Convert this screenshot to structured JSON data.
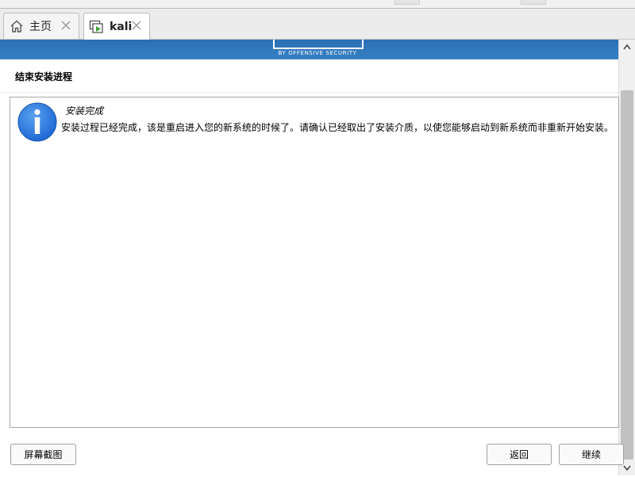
{
  "tabs": [
    {
      "label": "主页",
      "icon": "home-icon"
    },
    {
      "label": "kali",
      "icon": "vm-icon"
    }
  ],
  "banner": {
    "byline": "BY OFFENSIVE SECURITY"
  },
  "step": {
    "title": "结束安装进程"
  },
  "notice": {
    "icon": "info-icon",
    "title": "安装完成",
    "body": "安装过程已经完成，该是重启进入您的新系统的时候了。请确认已经取出了安装介质，以使您能够启动到新系统而非重新开始安装。"
  },
  "buttons": {
    "screenshot": "屏幕截图",
    "back": "返回",
    "continue": "继续"
  },
  "colors": {
    "banner": "#3178bd",
    "info_icon": "#2f7fe0"
  }
}
